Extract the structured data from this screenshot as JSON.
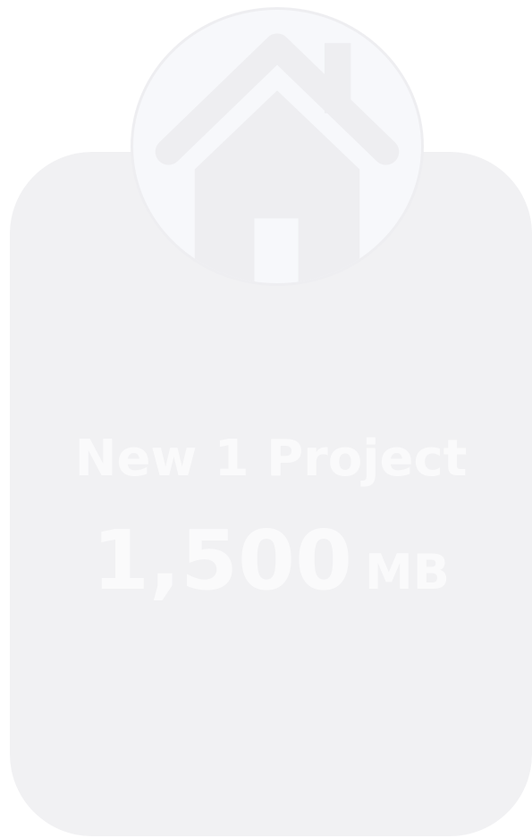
{
  "card": {
    "title": "New 1 Project",
    "size_value": "1,500",
    "size_unit": "MB",
    "icon": "house-icon"
  },
  "colors": {
    "card_bg": "#f1f1f3",
    "icon_circle_bg": "#f7f8fb",
    "icon_fill": "#eeeef1",
    "text": "#fafafb"
  }
}
